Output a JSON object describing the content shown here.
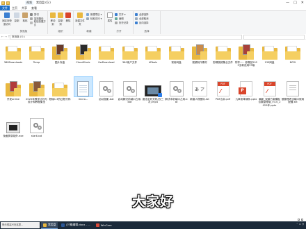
{
  "window": {
    "tab_text": "视频",
    "title": "常用盘 (G:)",
    "controls": [
      "—",
      "□",
      "✕"
    ]
  },
  "ribbon_tabs": [
    "文件",
    "主页",
    "共享",
    "查看"
  ],
  "ribbon": {
    "clipboard": {
      "pin": "固定到快速访问",
      "copy": "复制",
      "paste": "粘贴",
      "cut": "剪切",
      "copy_path": "复制路径",
      "paste_shortcut": "粘贴快捷方式",
      "group": "剪贴板"
    },
    "organize": {
      "move_to": "移动到",
      "copy_to": "复制到",
      "delete": "删除",
      "rename": "重命名",
      "group": "组织"
    },
    "new": {
      "new_folder": "新建文件夹",
      "new_item": "新建项目 ▾",
      "easy_access": "轻松访问 ▾",
      "group": "新建"
    },
    "open": {
      "properties": "属性",
      "open": "打开 ▾",
      "edit": "编辑",
      "history": "历史记录",
      "group": "打开"
    },
    "select": {
      "select_all": "全部选择",
      "select_none": "全部取消",
      "invert": "反向选择",
      "group": "选择"
    }
  },
  "address": {
    "path": "常用盘 (G:)",
    "nav": "← → ↑"
  },
  "files": [
    {
      "label": "360Downloads",
      "type": "folder"
    },
    {
      "label": "Temp",
      "type": "folder"
    },
    {
      "label": "图片存盘",
      "type": "folder-thumb",
      "thumb": "#6a3b2a"
    },
    {
      "label": "CloudMusic",
      "type": "folder-thumb",
      "thumb": "#2b2b2b"
    },
    {
      "label": "KwDownload",
      "type": "folder"
    },
    {
      "label": "360用户文件",
      "type": "folder"
    },
    {
      "label": "IATools",
      "type": "folder"
    },
    {
      "label": "常用网盘",
      "type": "folder"
    },
    {
      "label": "视频制作素材",
      "type": "folder-thumb",
      "thumb": "#c98a4a"
    },
    {
      "label": "剪辑视频集合文件",
      "type": "folder"
    },
    {
      "label": "附件一：参赛回2025全新适用V9版",
      "type": "folder-thumb",
      "thumb": "#a8413a"
    },
    {
      "label": "133网盘",
      "type": "folder"
    },
    {
      "label": "NPOI",
      "type": "folder"
    },
    {
      "label": "开发online",
      "type": "folder-thumb",
      "thumb": "#b23b3b"
    },
    {
      "label": "2025年教学计划与设计和教程集全",
      "type": "folder-thumb",
      "thumb": "#8a5a3a"
    },
    {
      "label": "程瑞1.3的过程代码",
      "type": "folder"
    },
    {
      "label": "micro...",
      "type": "doc",
      "selected": true
    },
    {
      "label": "启动投影.bat",
      "type": "gear"
    },
    {
      "label": "启动解决前端口占用.bat",
      "type": "gear"
    },
    {
      "label": "魔法定时关机(仅三次).mp4",
      "type": "video"
    },
    {
      "label": "解决本机端口占用.bat",
      "type": "gear"
    },
    {
      "label": "新建人物图标.txt",
      "type": "txtimg",
      "glyph": "あ ア"
    },
    {
      "label": "PDF合并.pdf",
      "type": "pdf"
    },
    {
      "label": "九章变革课件.pptx",
      "type": "ppt"
    },
    {
      "label": "最新_双碳方案模板合集整理版_V3.0_2025年.pptx",
      "type": "pdf"
    },
    {
      "label": "做管理考试端口使用配置.txt",
      "type": "note"
    },
    {
      "label": "免截屏录制外.exe",
      "type": "exe"
    },
    {
      "label": "start.bat",
      "type": "gear"
    }
  ],
  "subtitle": "大家好",
  "status": {
    "text": ""
  },
  "taskbar": {
    "search": "快乐很高兴在这里...",
    "items": [
      {
        "label": "常用盘",
        "color": "#e9b840",
        "active": true
      },
      {
        "label": "[只能编辑.docx - ...",
        "color": "#2b5797",
        "active": false
      },
      {
        "label": "WinCam",
        "color": "#d94a3a",
        "active": false
      }
    ]
  },
  "colors": {
    "accent": "#1e6fc7",
    "taskbar": "#1b2a3a",
    "folder": "#e9b840"
  }
}
